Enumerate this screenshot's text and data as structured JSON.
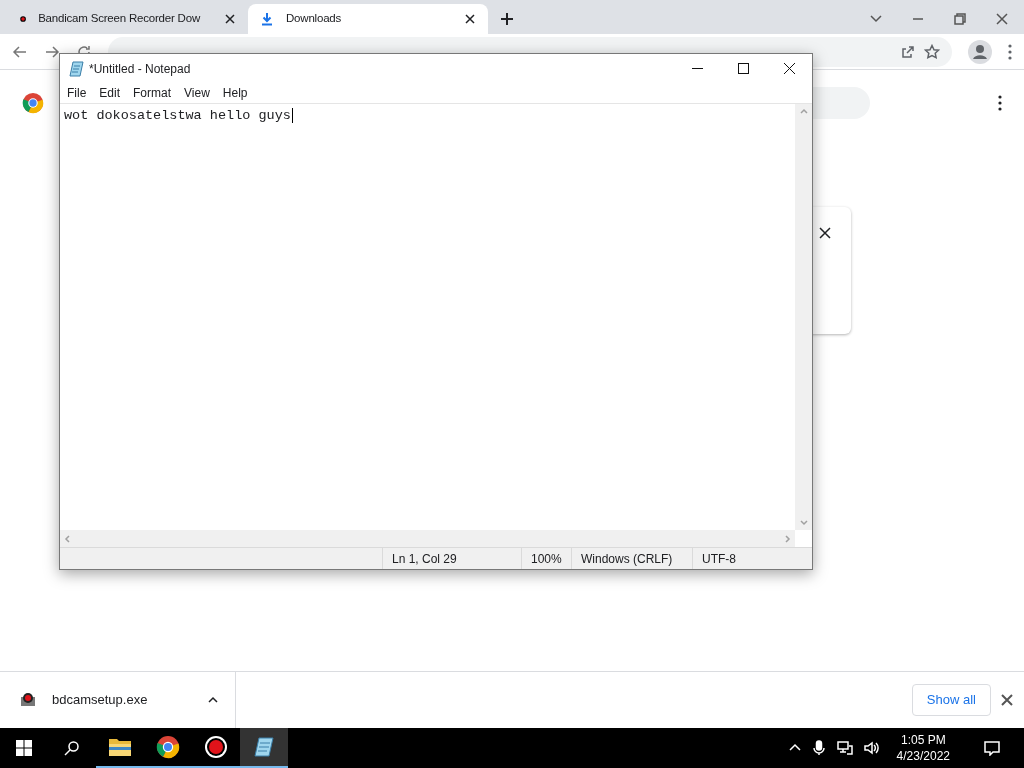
{
  "browser": {
    "tabs": [
      {
        "title": "Bandicam Screen Recorder Dow",
        "kind": "bandicam",
        "selected": false
      },
      {
        "title": "Downloads",
        "kind": "download",
        "selected": true
      }
    ]
  },
  "notepad": {
    "title": "*Untitled - Notepad",
    "menu": [
      "File",
      "Edit",
      "Format",
      "View",
      "Help"
    ],
    "text": "wot dokosatelstwa hello guys",
    "status": [
      "Ln 1, Col 29",
      "100%",
      "Windows (CRLF)",
      "UTF-8"
    ]
  },
  "download_shelf": {
    "file": "bdcamsetup.exe",
    "show_all": "Show all"
  },
  "taskbar": {
    "apps": [
      {
        "kind": "explorer",
        "selected": false
      },
      {
        "kind": "chrome",
        "selected": false
      },
      {
        "kind": "bandicam",
        "selected": false
      },
      {
        "kind": "notepad",
        "selected": true
      }
    ],
    "time": "1:05 PM",
    "date": "4/23/2022"
  }
}
